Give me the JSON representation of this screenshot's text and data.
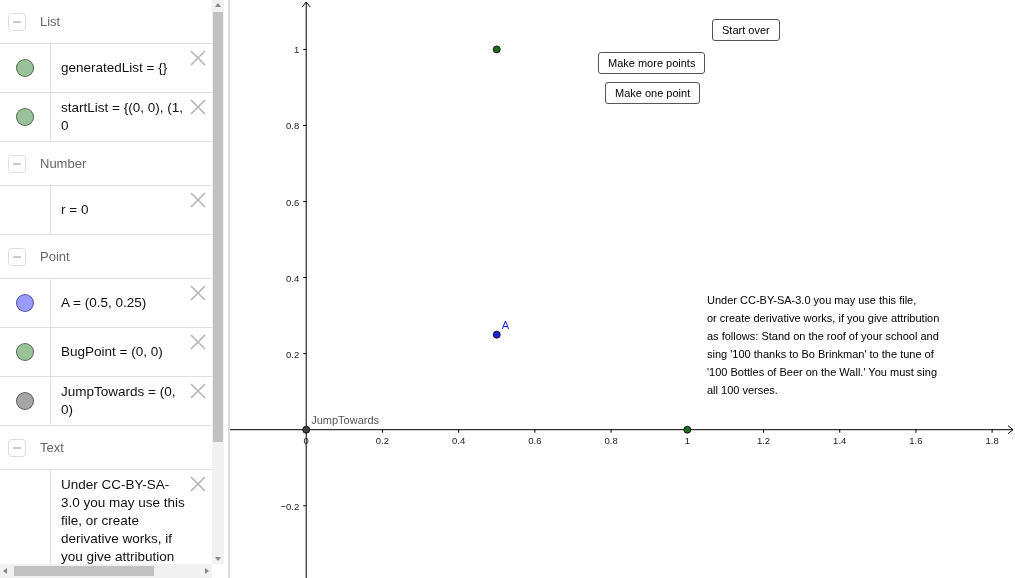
{
  "algebra": {
    "sections": [
      {
        "title": "List",
        "expanded": true,
        "items": [
          {
            "text": "generatedList = {}",
            "color": "#99c299"
          },
          {
            "text": "startList = {(0, 0), (1, 0",
            "color": "#99c299"
          }
        ]
      },
      {
        "title": "Number",
        "expanded": true,
        "items": [
          {
            "text": "r = 0"
          }
        ]
      },
      {
        "title": "Point",
        "expanded": true,
        "items": [
          {
            "text": "A = (0.5, 0.25)",
            "color": "#9999ff"
          },
          {
            "text": "BugPoint = (0, 0)",
            "color": "#99c299"
          },
          {
            "text": "JumpTowards = (0, 0)",
            "color": "#a6a6a6"
          }
        ]
      },
      {
        "title": "Text",
        "expanded": true,
        "items": [
          {
            "text": "Under CC-BY-SA-3.0 you may use this file, or create derivative works, if you give attribution"
          }
        ]
      }
    ]
  },
  "graphics": {
    "buttons": [
      {
        "label": "Start over"
      },
      {
        "label": "Make more points"
      },
      {
        "label": "Make one point"
      }
    ],
    "license_text": "Under CC-BY-SA-3.0 you may use this file,\nor create derivative works, if you give attribution\nas follows: Stand on the roof of your school and\nsing '100 thanks to Bo Brinkman' to the tune of\n'100 Bottles of Beer on the Wall.' You must sing\nall 100 verses.",
    "chart_data": {
      "type": "scatter",
      "xlim": [
        -0.2,
        1.86
      ],
      "ylim": [
        -0.39,
        1.13
      ],
      "xticks": [
        {
          "value": 0,
          "label": "0"
        },
        0.2,
        0.4,
        0.6,
        0.8,
        1,
        1.2,
        1.4,
        1.6,
        1.8
      ],
      "yticks": [
        {
          "value": -0.2,
          "label": "−0.2"
        },
        0.2,
        0.4,
        0.6,
        0.8,
        1
      ],
      "x": [
        0,
        0.5,
        0.5,
        1
      ],
      "series": [
        {
          "name": "JumpTowards",
          "color": "#404040",
          "values": [
            0,
            null,
            null,
            null
          ]
        },
        {
          "name": "A",
          "color": "#1f1fe6",
          "values": [
            null,
            null,
            0.25,
            null
          ]
        },
        {
          "color": "#1e6b1e",
          "values": [
            null,
            1,
            null,
            0
          ]
        }
      ]
    }
  }
}
